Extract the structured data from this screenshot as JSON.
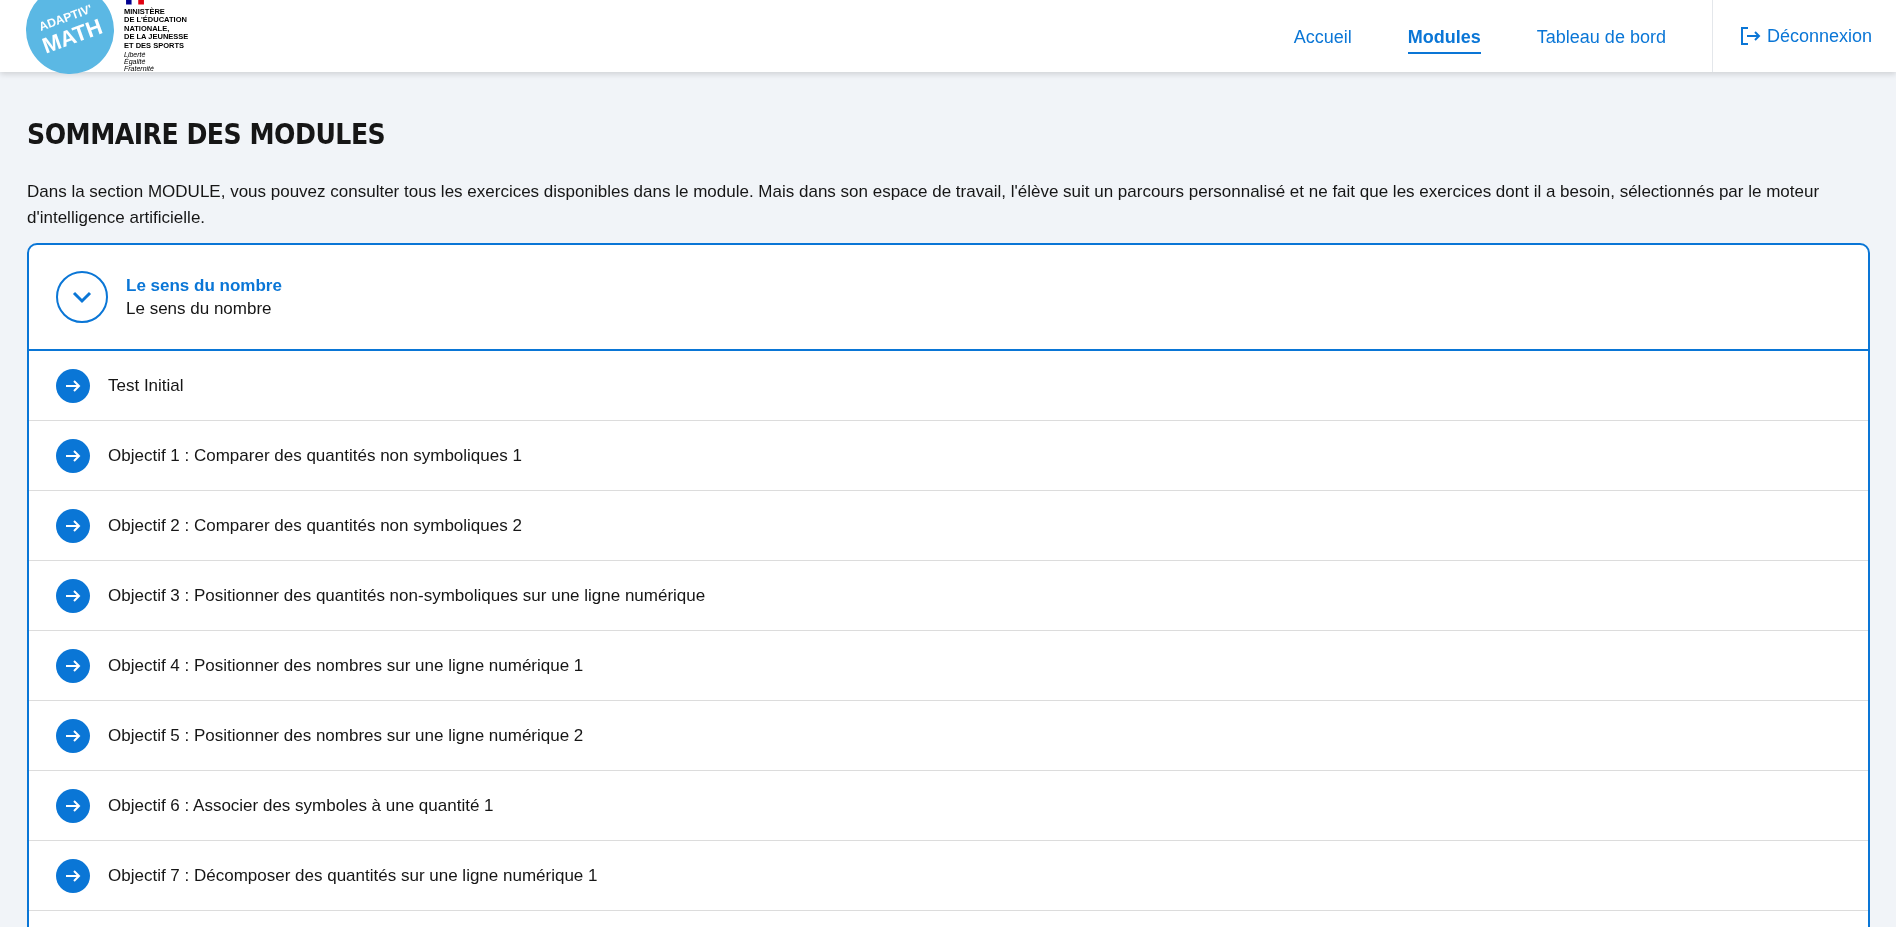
{
  "logo": {
    "line_1": "ADAPTIV'",
    "line_2": "MATH"
  },
  "ministry": {
    "lines": [
      "MINISTÈRE",
      "DE L'ÉDUCATION",
      "NATIONALE,",
      "DE LA JEUNESSE",
      "ET DES SPORTS"
    ],
    "motto": [
      "Liberté",
      "Égalité",
      "Fraternité"
    ]
  },
  "nav": [
    {
      "label": "Accueil",
      "selected": false
    },
    {
      "label": "Modules",
      "selected": true
    },
    {
      "label": "Tableau de bord",
      "selected": false
    }
  ],
  "logout": {
    "label": "Déconnexion"
  },
  "page_title": "SOMMAIRE DES MODULES",
  "intro": "Dans la section MODULE, vous pouvez consulter tous les exercices disponibles dans le module. Mais dans son espace de travail, l'élève suit un parcours personnalisé et ne fait que les exercices dont il a besoin, sélectionnés par le moteur d'intelligence artificielle.",
  "module": {
    "title": "Le sens du nombre",
    "subtitle": "Le sens du nombre",
    "expanded": true,
    "items": [
      "Test Initial",
      "Objectif 1 : Comparer des quantités non symboliques 1",
      "Objectif 2 : Comparer des quantités non symboliques 2",
      "Objectif 3 : Positionner des quantités non-symboliques sur une ligne numérique",
      "Objectif 4 : Positionner des nombres sur une ligne numérique 1",
      "Objectif 5 : Positionner des nombres sur une ligne numérique 2",
      "Objectif 6 : Associer des symboles à une quantité 1",
      "Objectif 7 : Décomposer des quantités sur une ligne numérique 1"
    ]
  }
}
